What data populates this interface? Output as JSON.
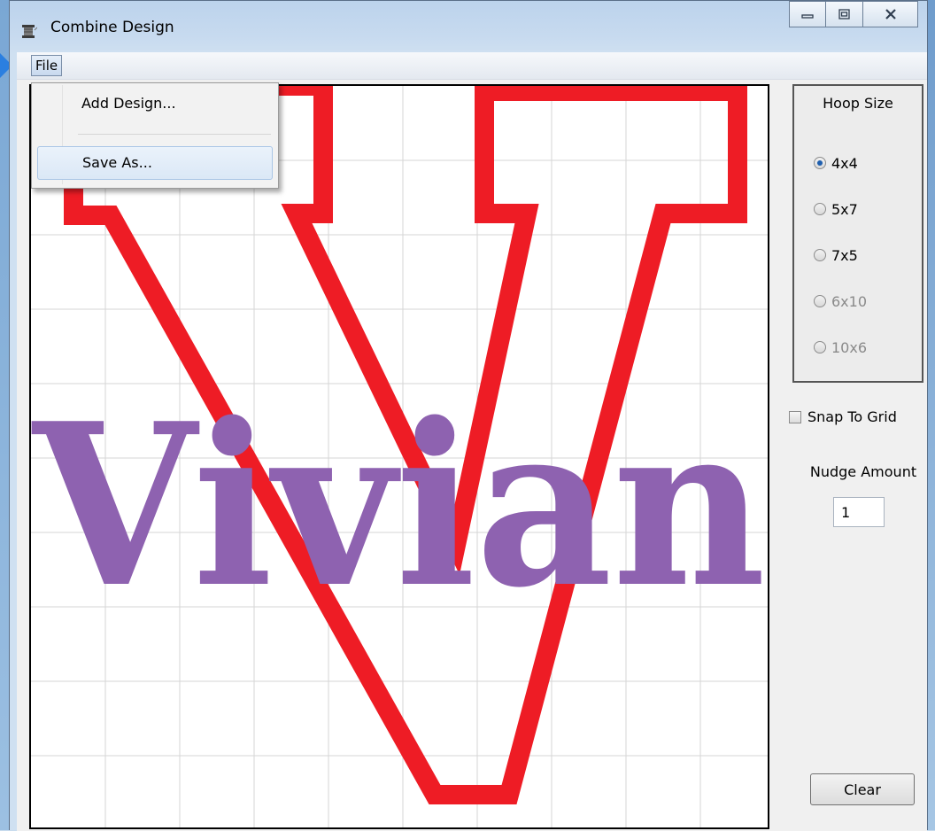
{
  "window": {
    "title": "Combine Design",
    "caption_icons": [
      "minimize-icon",
      "maximize-icon",
      "close-icon"
    ]
  },
  "menu": {
    "file_label": "File",
    "items": [
      "Add Design...",
      "Save As..."
    ]
  },
  "sidebar": {
    "hoop_title": "Hoop Size",
    "hoop_options": [
      {
        "label": "4x4",
        "selected": true,
        "enabled": true
      },
      {
        "label": "5x7",
        "selected": false,
        "enabled": true
      },
      {
        "label": "7x5",
        "selected": false,
        "enabled": true
      },
      {
        "label": "6x10",
        "selected": false,
        "enabled": false
      },
      {
        "label": "10x6",
        "selected": false,
        "enabled": false
      }
    ],
    "snap_label": "Snap To Grid",
    "snap_checked": false,
    "nudge_label": "Nudge Amount",
    "nudge_value": "1",
    "clear_label": "Clear"
  },
  "canvas": {
    "text_design": "Vivian",
    "colors": {
      "outline_v": "#ee1c25",
      "name_text": "#8e62b0",
      "grid": "#d6d6d6"
    }
  }
}
